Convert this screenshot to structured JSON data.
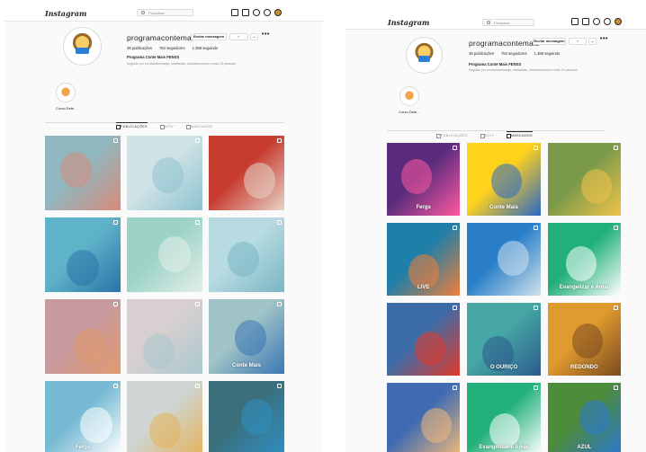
{
  "header": {
    "logo_text": "Instagram",
    "search_placeholder": "Pesquisar"
  },
  "profile": {
    "username": "programacontemais",
    "message_button": "Enviar mensagem",
    "more_button": "•••",
    "stats": {
      "posts": "36 publicações",
      "followers": "762 seguidores",
      "following": "1.388 seguindo"
    },
    "full_name": "Programa Conte Mais FENSS",
    "followed_by": "Seguido por rochaizabelmanja, ofantasias, ofcaminhosnos e mais 19 pessoas",
    "highlight_label": "Curso Dete..."
  },
  "tabs": {
    "posts": "PUBLICAÇÕES",
    "igtv": "IGTV",
    "tagged": "MARCADOS"
  },
  "left_tiles": [
    {
      "name": "tile-1",
      "c1": "#8fb8c0",
      "c2": "#d98a7a",
      "caption": ""
    },
    {
      "name": "tile-2",
      "c1": "#cfe3e6",
      "c2": "#8fc3cf",
      "caption": ""
    },
    {
      "name": "tile-3",
      "c1": "#c73b2e",
      "c2": "#e7d3c8",
      "caption": ""
    },
    {
      "name": "tile-4",
      "c1": "#5fb3c9",
      "c2": "#2a74a8",
      "caption": ""
    },
    {
      "name": "tile-5",
      "c1": "#9dd3c7",
      "c2": "#e3eee9",
      "caption": ""
    },
    {
      "name": "tile-6",
      "c1": "#b7dbe0",
      "c2": "#79b6c4",
      "caption": ""
    },
    {
      "name": "tile-7",
      "c1": "#c79a9f",
      "c2": "#e09a6f",
      "caption": ""
    },
    {
      "name": "tile-8",
      "c1": "#d8d0d0",
      "c2": "#a9c9cf",
      "caption": ""
    },
    {
      "name": "tile-9",
      "c1": "#9fc3c6",
      "c2": "#3a77b5",
      "caption": "Conte Mais"
    },
    {
      "name": "tile-10",
      "c1": "#75b9d3",
      "c2": "#ffffff",
      "caption": "Fergs"
    },
    {
      "name": "tile-11",
      "c1": "#cfd6d4",
      "c2": "#e4b25a",
      "caption": ""
    },
    {
      "name": "tile-12",
      "c1": "#3b6f7c",
      "c2": "#2f8fc2",
      "caption": ""
    }
  ],
  "right_tiles": [
    {
      "name": "tile-1",
      "c1": "#5b2c7d",
      "c2": "#ff5aa0",
      "caption": "Fergs"
    },
    {
      "name": "tile-2",
      "c1": "#ffd21c",
      "c2": "#2a67c8",
      "caption": "Conte Mais"
    },
    {
      "name": "tile-3",
      "c1": "#7a9a4a",
      "c2": "#f0c34a",
      "caption": ""
    },
    {
      "name": "tile-4",
      "c1": "#1e7fa8",
      "c2": "#f07e3a",
      "caption": "LIVE"
    },
    {
      "name": "tile-5",
      "c1": "#2a7fc8",
      "c2": "#cfe1ec",
      "caption": ""
    },
    {
      "name": "tile-6",
      "c1": "#21b07a",
      "c2": "#ffffff",
      "caption": "Evangelizar é Amar"
    },
    {
      "name": "tile-7",
      "c1": "#3c6ca8",
      "c2": "#e23a2a",
      "caption": ""
    },
    {
      "name": "tile-8",
      "c1": "#46a7a4",
      "c2": "#2c5a8c",
      "caption": "O OURIÇO"
    },
    {
      "name": "tile-9",
      "c1": "#e09b2f",
      "c2": "#7b4a1f",
      "caption": "REDONDO"
    },
    {
      "name": "tile-10",
      "c1": "#3f6bb1",
      "c2": "#f1b87a",
      "caption": ""
    },
    {
      "name": "tile-11",
      "c1": "#21b07a",
      "c2": "#ffffff",
      "caption": "Evangelizar é Amar"
    },
    {
      "name": "tile-12",
      "c1": "#4d8c3a",
      "c2": "#2b77d2",
      "caption": "AZUL"
    }
  ]
}
